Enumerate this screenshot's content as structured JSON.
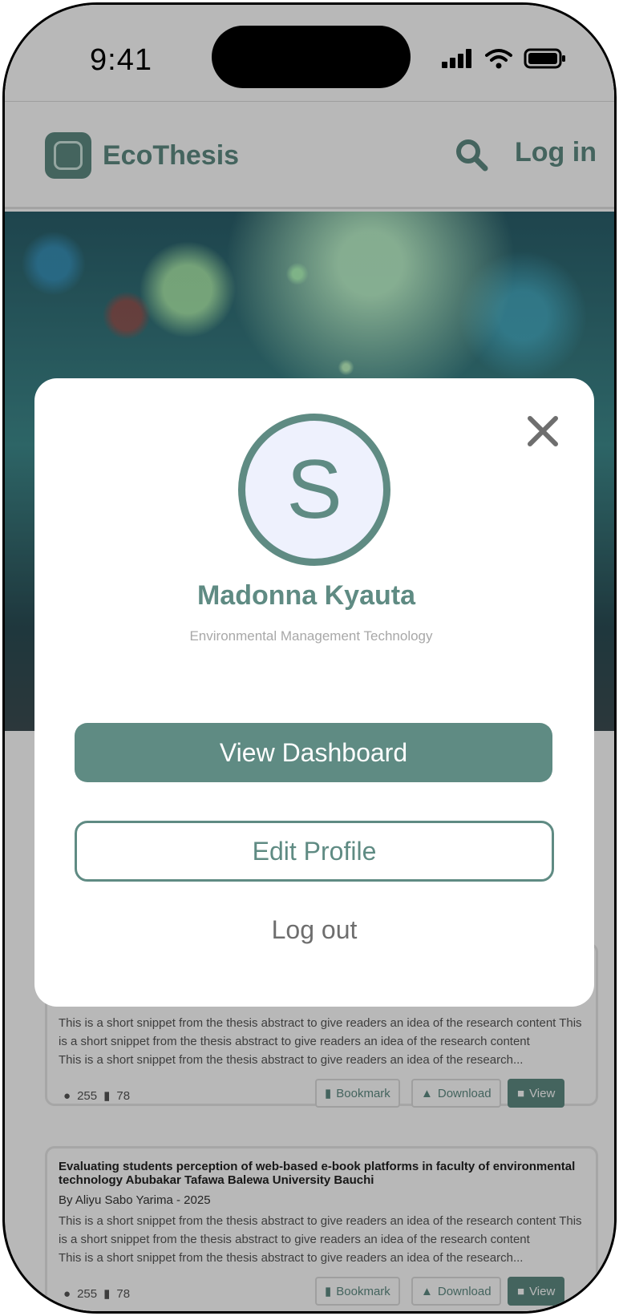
{
  "status_bar": {
    "time": "9:41"
  },
  "header": {
    "brand": "EcoThesis",
    "login_label": "Log in"
  },
  "cards": [
    {
      "title": "",
      "author": "",
      "snippet_lines": [
        "This is a short snippet from the thesis abstract to give readers  an idea of the research content This",
        "is a short snippet from the thesis abstract to give readers  an idea of the research content",
        "This is a short snippet from the thesis abstract to give readers an idea of the research..."
      ],
      "views": "255",
      "bookmarks": "78"
    },
    {
      "title": "Evaluating students perception of web-based e-book platforms in faculty of environmental technology Abubakar Tafawa Balewa University Bauchi",
      "author": "By Aliyu Sabo Yarima  - 2025",
      "snippet_lines": [
        "This is a short snippet from the thesis abstract to give readers  an idea of the research content This",
        "is a short snippet from the thesis abstract to give readers  an idea of the research content",
        "This is a short snippet from the thesis abstract to give readers an idea of the research..."
      ],
      "views": "255",
      "bookmarks": "78"
    }
  ],
  "card_actions": {
    "bookmark": "Bookmark",
    "download": "Download",
    "view": "View"
  },
  "modal": {
    "avatar_letter": "S",
    "name": "Madonna Kyauta",
    "department": "Environmental Management Technology",
    "view_dashboard": "View Dashboard",
    "edit_profile": "Edit Profile",
    "log_out": "Log out"
  },
  "colors": {
    "accent": "#5f8b83",
    "overlay": "rgba(0,0,0,0.28)"
  }
}
